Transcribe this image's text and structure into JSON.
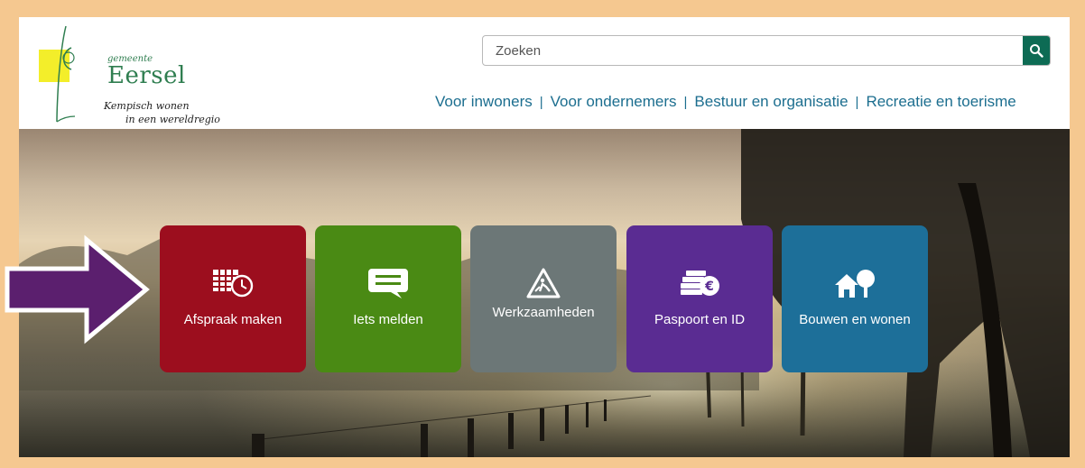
{
  "logo": {
    "small": "gemeente",
    "name": "Eersel",
    "tagline_line1": "Kempisch wonen",
    "tagline_line2": "in een wereldregio"
  },
  "search": {
    "placeholder": "Zoeken",
    "icon": "search-icon"
  },
  "nav": [
    "Voor inwoners",
    "Voor ondernemers",
    "Bestuur en organisatie",
    "Recreatie en toerisme"
  ],
  "tiles": [
    {
      "label": "Afspraak maken",
      "icon": "calendar-clock-icon",
      "color": "#9c0e1e"
    },
    {
      "label": "Iets melden",
      "icon": "speech-bubble-icon",
      "color": "#4a8a14"
    },
    {
      "label": "Werkzaamheden",
      "icon": "roadwork-icon",
      "color": "#6c7777"
    },
    {
      "label": "Paspoort en ID",
      "icon": "coins-euro-icon",
      "color": "#5a2c92"
    },
    {
      "label": "Bouwen en wonen",
      "icon": "house-tree-icon",
      "color": "#1d6f99"
    }
  ],
  "colors": {
    "frame": "#f5c890",
    "accent": "#0d6b54",
    "nav_link": "#1c6e8f",
    "arrow": "#5b1f6e"
  }
}
